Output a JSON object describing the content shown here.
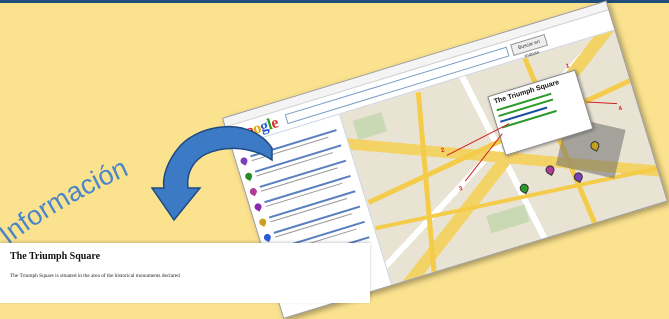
{
  "background_color": "#fbe28f",
  "label": {
    "text": "Información",
    "color": "#4a86c8"
  },
  "arrow": {
    "color": "#3c7ac6",
    "outline": "#1e4a82"
  },
  "maps_screenshot": {
    "logo_letters": [
      "G",
      "o",
      "o",
      "g",
      "l",
      "e"
    ],
    "search_button": "Buscar en mapas",
    "popup_title": "The Triumph Square",
    "callout_numbers": [
      "1",
      "2",
      "3",
      "4"
    ]
  },
  "document": {
    "title": "The Triumph Square",
    "first_line": "The Triumph Square is situated in the area of the historical monuments declared"
  }
}
